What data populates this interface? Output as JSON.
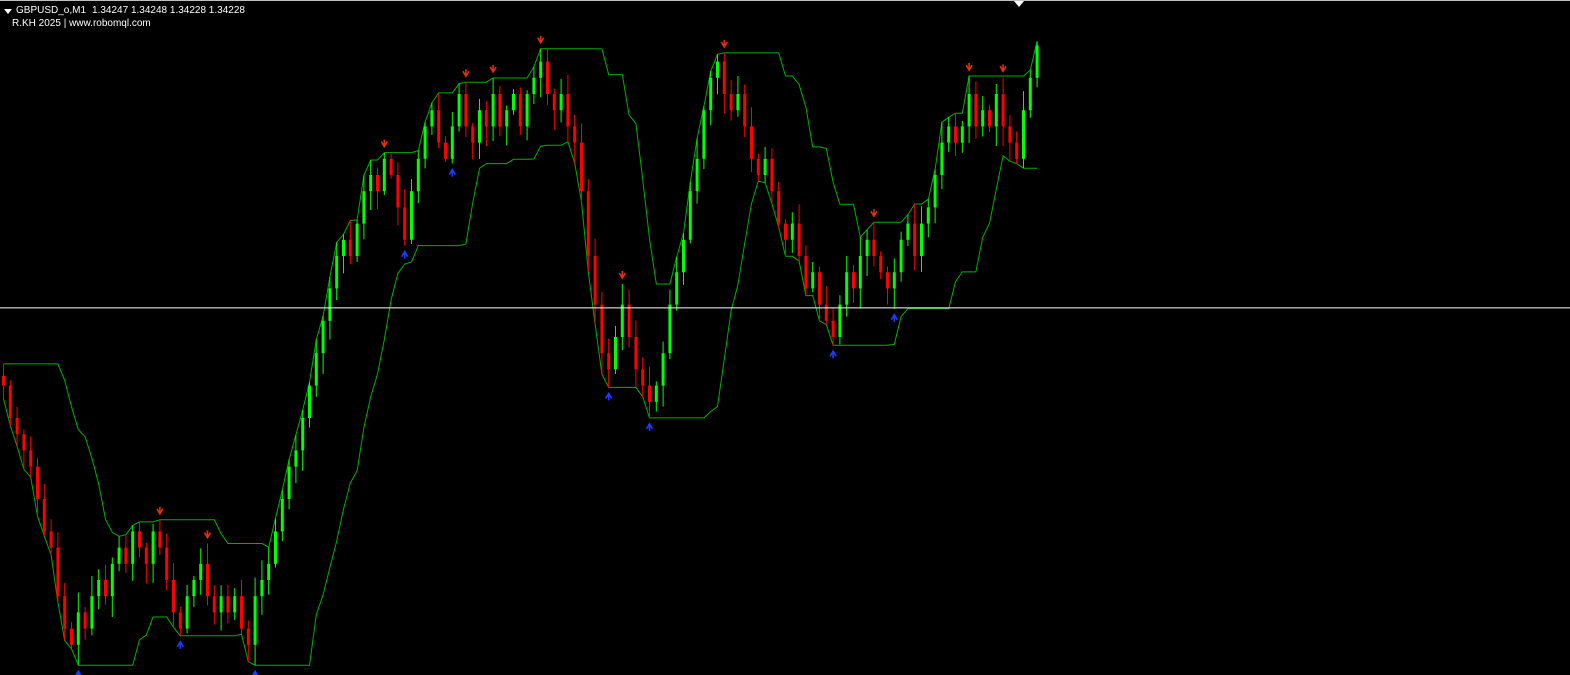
{
  "header": {
    "symbol_timeframe": "GBPUSD_o,M1",
    "ohlc": "1.34247 1.34248 1.34228 1.34228",
    "indicator_label": "R.KH 2025 | www.robomql.com"
  },
  "colors": {
    "background": "#000000",
    "bull": "#00ff00",
    "bear": "#ff0000",
    "band": "#00b000",
    "buy_arrow": "#1e3cff",
    "sell_arrow": "#e03010",
    "price_line": "#ffffff"
  },
  "chart_data": {
    "type": "candlestick",
    "symbol": "GBPUSD_o",
    "timeframe": "M1",
    "bid_line": 1.34228,
    "ylim": [
      1.3401,
      1.3441
    ],
    "closes": [
      1.3418,
      1.3416,
      1.3415,
      1.3414,
      1.3413,
      1.3411,
      1.3409,
      1.3408,
      1.3405,
      1.3403,
      1.3402,
      1.3404,
      1.3403,
      1.3405,
      1.3406,
      1.3405,
      1.3407,
      1.3408,
      1.3407,
      1.3409,
      1.3408,
      1.3407,
      1.3409,
      1.3408,
      1.3406,
      1.3404,
      1.3403,
      1.3405,
      1.3406,
      1.3407,
      1.3405,
      1.3404,
      1.3405,
      1.3404,
      1.3405,
      1.3403,
      1.3402,
      1.3405,
      1.3406,
      1.3407,
      1.3409,
      1.3411,
      1.3413,
      1.3414,
      1.3416,
      1.3418,
      1.342,
      1.3422,
      1.3424,
      1.3426,
      1.3427,
      1.3426,
      1.3428,
      1.343,
      1.3431,
      1.343,
      1.3432,
      1.3431,
      1.3429,
      1.3427,
      1.343,
      1.3432,
      1.3434,
      1.3435,
      1.3433,
      1.3432,
      1.3434,
      1.3436,
      1.3434,
      1.3433,
      1.3435,
      1.3434,
      1.3436,
      1.3434,
      1.3435,
      1.3436,
      1.3434,
      1.3436,
      1.3437,
      1.3438,
      1.3436,
      1.3435,
      1.3436,
      1.3434,
      1.3433,
      1.343,
      1.3426,
      1.3423,
      1.342,
      1.3419,
      1.3421,
      1.3423,
      1.3421,
      1.3419,
      1.3418,
      1.3417,
      1.3418,
      1.342,
      1.3423,
      1.3425,
      1.3427,
      1.343,
      1.3432,
      1.3435,
      1.3437,
      1.3438,
      1.3436,
      1.3435,
      1.3436,
      1.3434,
      1.3432,
      1.3431,
      1.3432,
      1.343,
      1.3428,
      1.3427,
      1.3428,
      1.3426,
      1.3424,
      1.3425,
      1.3423,
      1.3422,
      1.3421,
      1.3423,
      1.3425,
      1.3424,
      1.3426,
      1.3427,
      1.3426,
      1.3425,
      1.3424,
      1.3425,
      1.3427,
      1.3428,
      1.3426,
      1.3428,
      1.3429,
      1.3431,
      1.3433,
      1.3434,
      1.3433,
      1.3434,
      1.3436,
      1.3434,
      1.3435,
      1.3434,
      1.3436,
      1.3434,
      1.3433,
      1.3432,
      1.3435,
      1.3437,
      1.3439
    ]
  }
}
